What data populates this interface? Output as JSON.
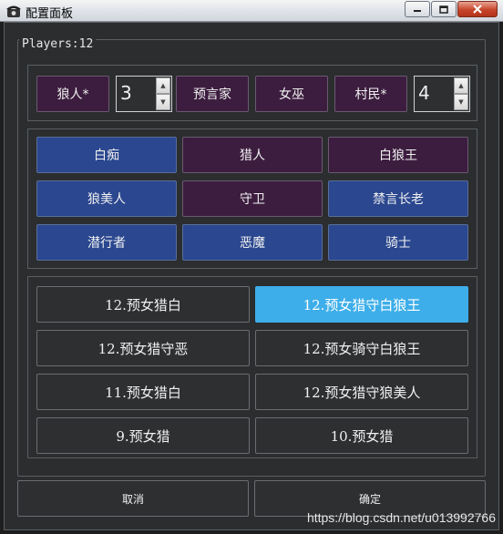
{
  "window": {
    "title": "配置面板"
  },
  "group": {
    "title": "Players:12"
  },
  "row_controls": {
    "wolf_label": "狼人*",
    "wolf_count": "3",
    "seer_label": "预言家",
    "witch_label": "女巫",
    "villager_label": "村民*",
    "villager_count": "4"
  },
  "roles": [
    {
      "label": "白痴",
      "color": "#2a478f"
    },
    {
      "label": "猎人",
      "color": "#3c1d3f"
    },
    {
      "label": "白狼王",
      "color": "#3c1d3f"
    },
    {
      "label": "狼美人",
      "color": "#2a478f"
    },
    {
      "label": "守卫",
      "color": "#3c1d3f"
    },
    {
      "label": "禁言长老",
      "color": "#2a478f"
    },
    {
      "label": "潜行者",
      "color": "#2a478f"
    },
    {
      "label": "恶魔",
      "color": "#2a478f"
    },
    {
      "label": "骑士",
      "color": "#2a478f"
    }
  ],
  "presets": [
    {
      "label": "12.预女猎白",
      "selected": false
    },
    {
      "label": "12.预女猎守白狼王",
      "selected": true
    },
    {
      "label": "12.预女猎守恶",
      "selected": false
    },
    {
      "label": "12.预女骑守白狼王",
      "selected": false
    },
    {
      "label": "11.预女猎白",
      "selected": false
    },
    {
      "label": "12.预女猎守狼美人",
      "selected": false
    },
    {
      "label": "9.预女猎",
      "selected": false
    },
    {
      "label": "10.预女猎",
      "selected": false
    }
  ],
  "footer": {
    "cancel_label": "取消",
    "ok_label": "确定"
  },
  "watermark": "https://blog.csdn.net/u013992766"
}
